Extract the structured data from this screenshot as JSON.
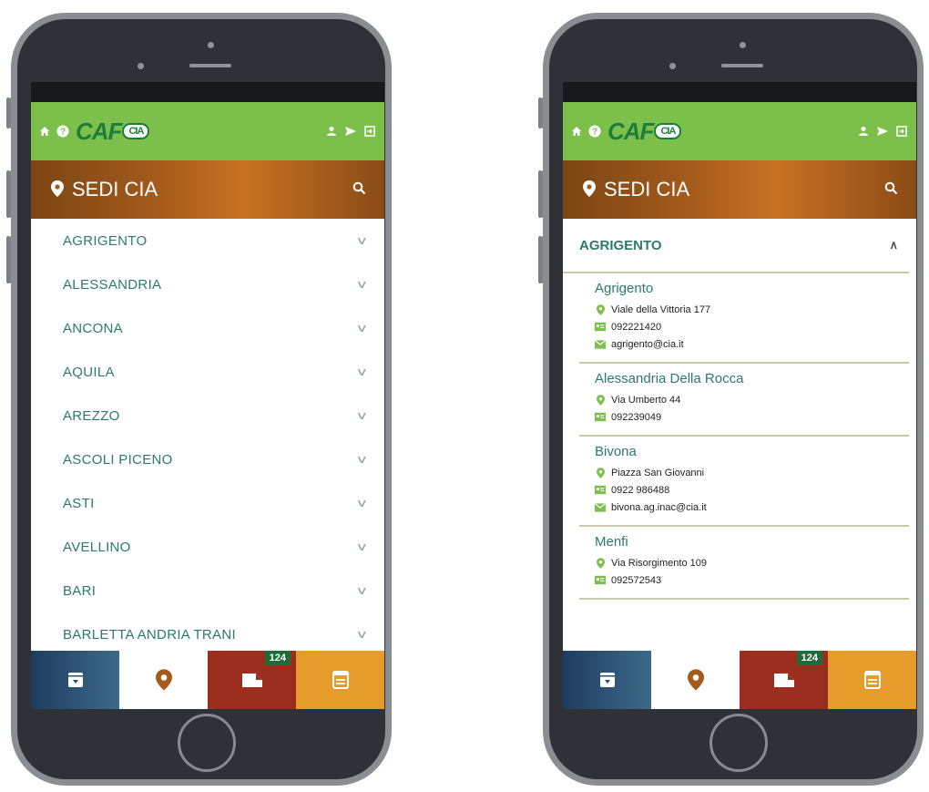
{
  "left_screen": {
    "header_title": "SEDI CIA",
    "logo_text": "CAF",
    "logo_badge": "CIA",
    "provinces": [
      "AGRIGENTO",
      "ALESSANDRIA",
      "ANCONA",
      "AQUILA",
      "AREZZO",
      "ASCOLI PICENO",
      "ASTI",
      "AVELLINO",
      "BARI",
      "BARLETTA ANDRIA TRANI"
    ],
    "badge_count": "124"
  },
  "right_screen": {
    "header_title": "SEDI CIA",
    "logo_text": "CAF",
    "logo_badge": "CIA",
    "expanded_province": "AGRIGENTO",
    "offices": [
      {
        "name": "Agrigento",
        "address": "Viale della Vittoria 177",
        "phone": "092221420",
        "email": "agrigento@cia.it"
      },
      {
        "name": "Alessandria Della Rocca",
        "address": "Via Umberto 44",
        "phone": "092239049"
      },
      {
        "name": "Bivona",
        "address": "Piazza San Giovanni",
        "phone": "0922 986488",
        "email": "bivona.ag.inac@cia.it"
      },
      {
        "name": "Menfi",
        "address": "Via Risorgimento 109",
        "phone": "092572543"
      }
    ],
    "badge_count": "124"
  },
  "colors": {
    "appbar_green": "#7cc04b",
    "header_brown": "#a35a1c",
    "text_teal": "#2d7a6b",
    "nav_blue": "#1f3c5e",
    "nav_red": "#9b2e1e",
    "nav_orange": "#e59c2a",
    "pin_brown": "#a35a1c"
  },
  "icons": [
    "home-icon",
    "help-icon",
    "user-icon",
    "send-icon",
    "logout-icon",
    "location-pin-icon",
    "search-icon",
    "archive-icon",
    "mail-icon",
    "calendar-list-icon",
    "chevron-down-icon",
    "chevron-up-icon",
    "id-card-icon"
  ]
}
